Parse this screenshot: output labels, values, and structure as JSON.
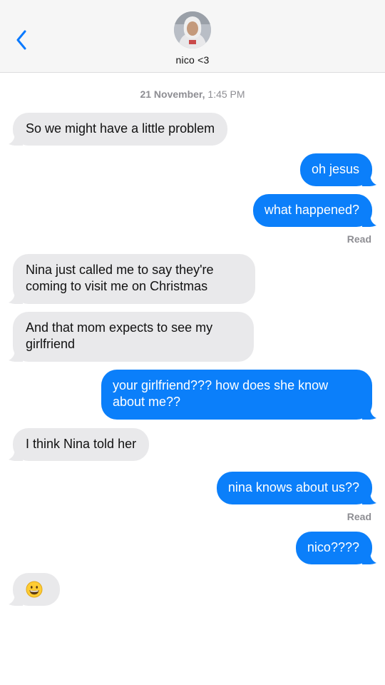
{
  "header": {
    "contact_name": "nico <3",
    "back_icon": "chevron-left-icon",
    "avatar_icon": "contact-photo"
  },
  "thread": {
    "date_label": "21 November,",
    "time_label": "1:45 PM"
  },
  "messages": [
    {
      "from": "them",
      "text": "So we might have a little problem"
    },
    {
      "from": "me",
      "text": "oh jesus"
    },
    {
      "from": "me",
      "text": "what happened?"
    },
    {
      "from": "them",
      "text": "Nina just called me to say they're coming to visit me on Christmas"
    },
    {
      "from": "them",
      "text": "And that mom expects to see my girlfriend"
    },
    {
      "from": "me",
      "text": "your girlfriend??? how does she know about me??"
    },
    {
      "from": "them",
      "text": "I think Nina told her"
    },
    {
      "from": "me",
      "text": "nina knows about us??"
    },
    {
      "from": "me",
      "text": "nico????"
    },
    {
      "from": "them",
      "emoji": "grinning-face",
      "text": ""
    }
  ],
  "receipts": {
    "read_1": "Read",
    "read_2": "Read"
  },
  "colors": {
    "sent_bubble": "#0b7ffa",
    "received_bubble": "#e9e9eb",
    "accent": "#0a7aff",
    "meta_text": "#8e8e93"
  }
}
